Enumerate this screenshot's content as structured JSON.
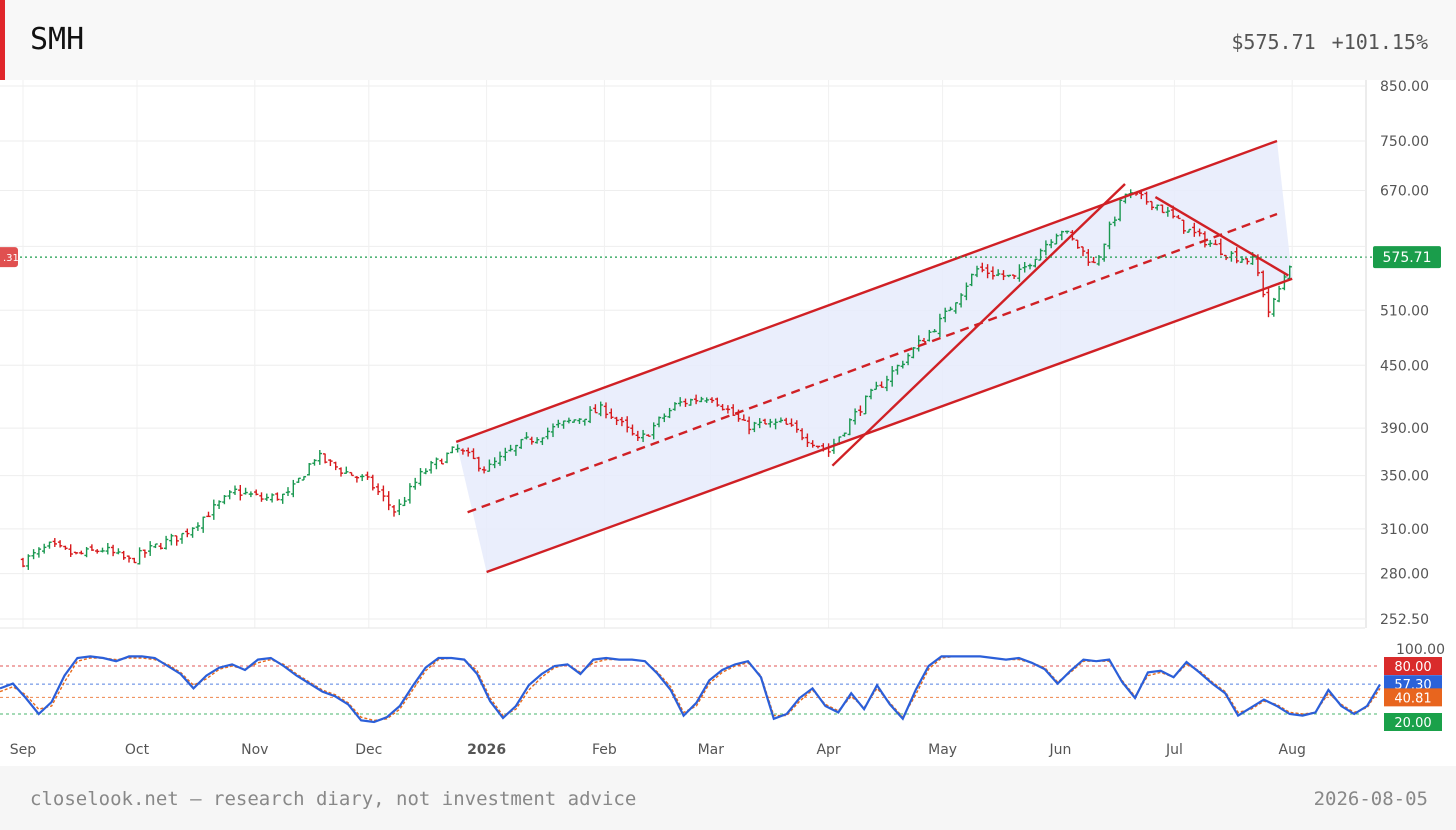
{
  "header": {
    "ticker": "SMH",
    "price": "$575.71",
    "change": "+101.15%"
  },
  "footer": {
    "left": "closelook.net — research diary, not investment advice",
    "right": "2026-08-05"
  },
  "colors": {
    "up": "#1a9850",
    "down": "#d7191c",
    "trend": "#d02025",
    "channel_fill": "#e6ebfc",
    "last_price": "#1a9d4b",
    "k_line": "#2b5fd9",
    "d_line": "#e86a1a"
  },
  "chart_data": [
    {
      "type": "ohlc",
      "title": "",
      "y_scale": "log",
      "y_ticks": [
        "850.00",
        "750.00",
        "670.00",
        "590.00",
        "510.00",
        "450.00",
        "390.00",
        "350.00",
        "310.00",
        "280.00",
        "252.50"
      ],
      "x_ticks": [
        "Sep",
        "Oct",
        "Nov",
        "Dec",
        "2026",
        "Feb",
        "Mar",
        "Apr",
        "May",
        "Jun",
        "Jul",
        "Aug"
      ],
      "last_price": "575.71",
      "left_tag": ".31",
      "close_path": [
        {
          "date": "2025-09-01",
          "value": 288
        },
        {
          "date": "2025-09-08",
          "value": 298
        },
        {
          "date": "2025-09-15",
          "value": 292
        },
        {
          "date": "2025-09-22",
          "value": 296
        },
        {
          "date": "2025-09-29",
          "value": 288
        },
        {
          "date": "2025-10-06",
          "value": 298
        },
        {
          "date": "2025-10-13",
          "value": 306
        },
        {
          "date": "2025-10-20",
          "value": 322
        },
        {
          "date": "2025-10-27",
          "value": 338
        },
        {
          "date": "2025-11-03",
          "value": 332
        },
        {
          "date": "2025-11-10",
          "value": 335
        },
        {
          "date": "2025-11-17",
          "value": 366
        },
        {
          "date": "2025-11-24",
          "value": 354
        },
        {
          "date": "2025-12-01",
          "value": 345
        },
        {
          "date": "2025-12-08",
          "value": 322
        },
        {
          "date": "2025-12-15",
          "value": 352
        },
        {
          "date": "2025-12-24",
          "value": 372
        },
        {
          "date": "2026-01-01",
          "value": 355
        },
        {
          "date": "2026-01-10",
          "value": 376
        },
        {
          "date": "2026-01-20",
          "value": 392
        },
        {
          "date": "2026-02-01",
          "value": 408
        },
        {
          "date": "2026-02-10",
          "value": 378
        },
        {
          "date": "2026-02-20",
          "value": 412
        },
        {
          "date": "2026-03-01",
          "value": 420
        },
        {
          "date": "2026-03-10",
          "value": 392
        },
        {
          "date": "2026-03-20",
          "value": 394
        },
        {
          "date": "2026-04-01",
          "value": 370
        },
        {
          "date": "2026-04-10",
          "value": 412
        },
        {
          "date": "2026-04-20",
          "value": 452
        },
        {
          "date": "2026-05-01",
          "value": 500
        },
        {
          "date": "2026-05-10",
          "value": 560
        },
        {
          "date": "2026-05-20",
          "value": 548
        },
        {
          "date": "2026-06-01",
          "value": 615
        },
        {
          "date": "2026-06-10",
          "value": 565
        },
        {
          "date": "2026-06-18",
          "value": 665
        },
        {
          "date": "2026-06-26",
          "value": 650
        },
        {
          "date": "2026-07-05",
          "value": 610
        },
        {
          "date": "2026-07-15",
          "value": 580
        },
        {
          "date": "2026-07-22",
          "value": 570
        },
        {
          "date": "2026-07-26",
          "value": 505
        },
        {
          "date": "2026-08-01",
          "value": 575.71
        }
      ],
      "channel": {
        "upper": [
          {
            "date": "2025-12-24",
            "value": 378
          },
          {
            "date": "2026-07-28",
            "value": 750
          }
        ],
        "mid": [
          {
            "date": "2025-12-27",
            "value": 322
          },
          {
            "date": "2026-07-28",
            "value": 635
          }
        ],
        "lower": [
          {
            "date": "2026-01-01",
            "value": 281
          },
          {
            "date": "2026-08-01",
            "value": 548
          }
        ]
      },
      "trendlines": [
        {
          "from": {
            "date": "2026-04-02",
            "value": 358
          },
          "to": {
            "date": "2026-06-18",
            "value": 680
          }
        },
        {
          "from": {
            "date": "2026-06-26",
            "value": 660
          },
          "to": {
            "date": "2026-07-31",
            "value": 552
          }
        }
      ]
    },
    {
      "type": "line",
      "title": "",
      "y_range": [
        0,
        100
      ],
      "y_ticks": [
        "100.00",
        "80.00",
        "57.30",
        "40.81",
        "20.00"
      ],
      "levels": [
        {
          "label": "80.00",
          "value": 80,
          "color": "#d92b2b"
        },
        {
          "label": "57.30",
          "value": 57.3,
          "color": "#2b62d9"
        },
        {
          "label": "40.81",
          "value": 40.81,
          "color": "#e8651e"
        },
        {
          "label": "20.00",
          "value": 20,
          "color": "#1aa14a"
        }
      ],
      "series": [
        {
          "values": [
            52,
            58,
            40,
            20,
            35,
            68,
            90,
            92,
            90,
            86,
            92,
            92,
            90,
            80,
            70,
            52,
            68,
            78,
            82,
            75,
            88,
            90,
            80,
            68,
            58,
            48,
            42,
            32,
            12,
            10,
            16,
            30,
            55,
            78,
            90,
            90,
            88,
            70,
            36,
            15,
            30,
            56,
            70,
            80,
            82,
            70,
            88,
            90,
            88,
            88,
            86,
            70,
            50,
            18,
            34,
            62,
            75,
            82,
            86,
            66,
            14,
            20,
            40,
            52,
            30,
            22,
            46,
            26,
            56,
            32,
            14,
            50,
            80,
            92,
            92,
            92,
            92,
            90,
            88,
            90,
            84,
            76,
            58,
            74,
            88,
            86,
            88,
            60,
            40,
            72,
            74,
            66,
            85,
            72,
            58,
            46,
            18,
            28,
            38,
            30,
            20,
            18,
            22,
            50,
            30,
            20,
            30,
            57
          ]
        },
        {
          "values": [
            48,
            54,
            44,
            26,
            30,
            60,
            86,
            90,
            90,
            88,
            90,
            90,
            88,
            82,
            72,
            56,
            64,
            76,
            80,
            76,
            84,
            88,
            82,
            70,
            60,
            50,
            44,
            34,
            16,
            12,
            14,
            26,
            50,
            74,
            88,
            90,
            88,
            74,
            40,
            18,
            26,
            50,
            66,
            78,
            82,
            72,
            84,
            88,
            88,
            88,
            86,
            72,
            54,
            22,
            30,
            58,
            72,
            80,
            84,
            68,
            18,
            18,
            36,
            50,
            32,
            24,
            42,
            28,
            52,
            34,
            16,
            44,
            76,
            90,
            92,
            92,
            92,
            90,
            88,
            88,
            84,
            78,
            60,
            72,
            86,
            86,
            86,
            62,
            42,
            68,
            72,
            66,
            82,
            74,
            60,
            48,
            22,
            26,
            36,
            32,
            22,
            20,
            22,
            46,
            32,
            22,
            28,
            52
          ]
        }
      ]
    }
  ]
}
